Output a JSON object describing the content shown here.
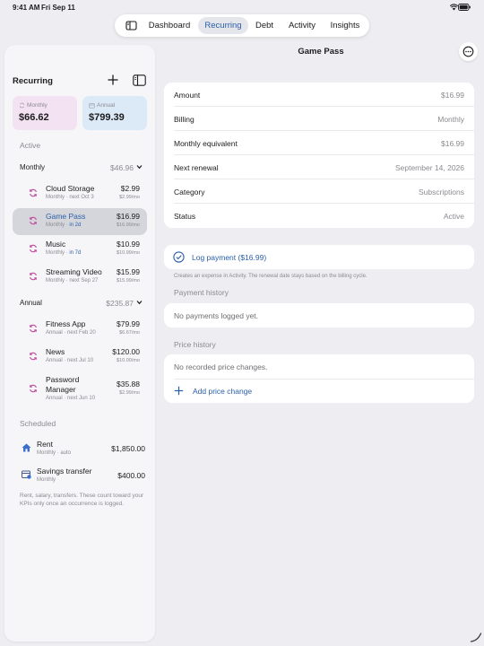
{
  "status_bar": {
    "time": "9:41 AM",
    "date": "Fri Sep 11"
  },
  "tabs": [
    {
      "label": "Dashboard",
      "active": false
    },
    {
      "label": "Recurring",
      "active": true
    },
    {
      "label": "Debt",
      "active": false
    },
    {
      "label": "Activity",
      "active": false
    },
    {
      "label": "Insights",
      "active": false
    }
  ],
  "sidebar": {
    "title": "Recurring",
    "cards": {
      "monthly": {
        "label": "Monthly",
        "value": "$66.62"
      },
      "annual": {
        "label": "Annual",
        "value": "$799.39"
      }
    },
    "active_label": "Active",
    "groups": [
      {
        "label": "Monthly",
        "total": "$46.96",
        "items": [
          {
            "name": "Cloud Storage",
            "sub": "Monthly · next Oct 3",
            "amount": "$2.99",
            "per": "$2.99/mo"
          },
          {
            "name": "Game Pass",
            "sub_a": "Monthly · ",
            "sub_b": "in 2d",
            "amount": "$16.99",
            "per": "$16.99/mo",
            "selected": true
          },
          {
            "name": "Music",
            "sub_a": "Monthly · ",
            "sub_b": "in 7d",
            "amount": "$10.99",
            "per": "$10.99/mo"
          },
          {
            "name": "Streaming Video",
            "sub": "Monthly · next Sep 27",
            "amount": "$15.99",
            "per": "$15.99/mo"
          }
        ]
      },
      {
        "label": "Annual",
        "total": "$235.87",
        "items": [
          {
            "name": "Fitness App",
            "sub": "Annual · next Feb 20",
            "amount": "$79.99",
            "per": "$6.67/mo"
          },
          {
            "name": "News",
            "sub": "Annual · next Jul 10",
            "amount": "$120.00",
            "per": "$10.00/mo"
          },
          {
            "name": "Password Manager",
            "sub": "Annual · next Jun 10",
            "amount": "$35.88",
            "per": "$2.99/mo"
          }
        ]
      }
    ],
    "scheduled_label": "Scheduled",
    "scheduled": [
      {
        "name": "Rent",
        "sub": "Monthly · auto",
        "amount": "$1,850.00",
        "icon": "house-icon"
      },
      {
        "name": "Savings transfer",
        "sub": "Monthly",
        "amount": "$400.00",
        "icon": "transfer-icon"
      }
    ],
    "note": "Rent, salary, transfers. These count toward your KPIs only once an occurrence is logged."
  },
  "detail": {
    "title": "Game Pass",
    "fields": [
      {
        "key": "Amount",
        "value": "$16.99"
      },
      {
        "key": "Billing",
        "value": "Monthly"
      },
      {
        "key": "Monthly equivalent",
        "value": "$16.99"
      },
      {
        "key": "Next renewal",
        "value": "September 14, 2026"
      },
      {
        "key": "Category",
        "value": "Subscriptions"
      },
      {
        "key": "Status",
        "value": "Active"
      }
    ],
    "log_payment": "Log payment ($16.99)",
    "hint": "Creates an expense in Activity. The renewal date stays based on the billing cycle.",
    "payment_history_label": "Payment history",
    "payment_history_empty": "No payments logged yet.",
    "price_history_label": "Price history",
    "price_history_empty": "No recorded price changes.",
    "add_price_change": "Add price change"
  },
  "colors": {
    "accent": "#2a5fa8",
    "recurring_icon": "#c04aa0",
    "card_monthly": "#f3e2f2",
    "card_annual": "#dceaf8"
  }
}
